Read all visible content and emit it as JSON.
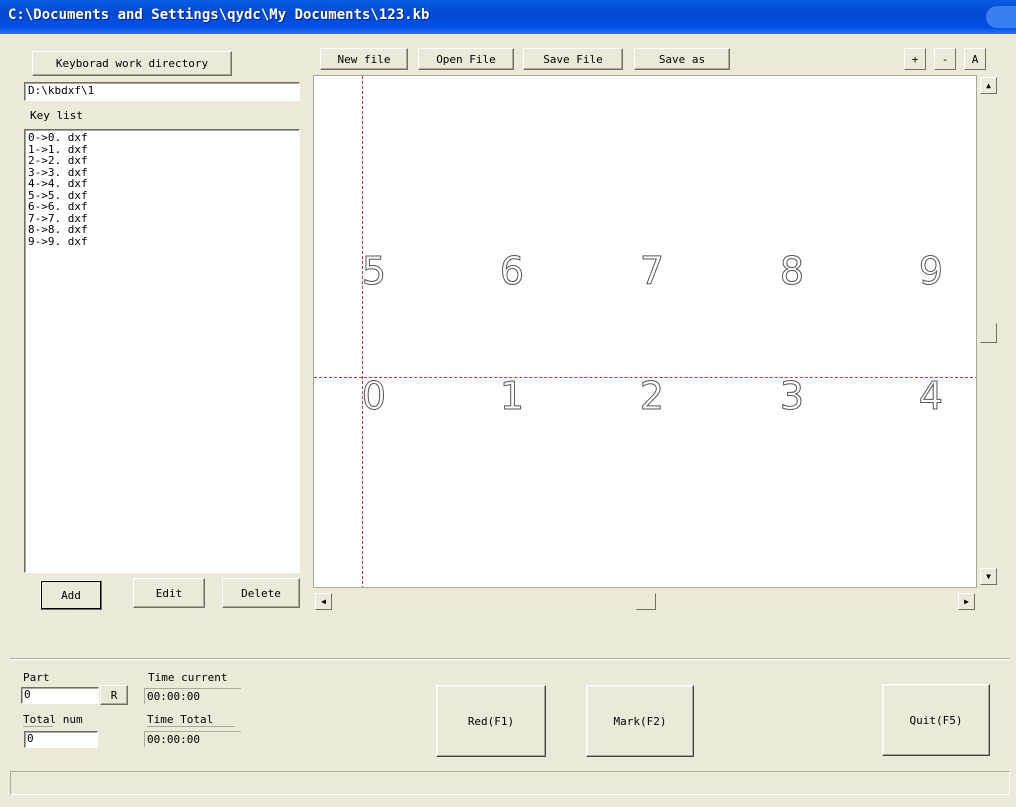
{
  "window": {
    "title": "C:\\Documents and Settings\\qydc\\My Documents\\123.kb"
  },
  "left": {
    "dir_button": "Keyborad work directory",
    "dir_path": "D:\\kbdxf\\1",
    "key_list_label": "Key list",
    "key_items": [
      "0->0. dxf",
      "1->1. dxf",
      "2->2. dxf",
      "3->3. dxf",
      "4->4. dxf",
      "5->5. dxf",
      "6->6. dxf",
      "7->7. dxf",
      "8->8. dxf",
      "9->9. dxf"
    ],
    "add_button": "Add",
    "edit_button": "Edit",
    "delete_button": "Delete"
  },
  "toolbar": {
    "new_file": "New file",
    "open_file": "Open File",
    "save_file": "Save File",
    "save_as": "Save as",
    "zoom_in": "+",
    "zoom_out": "-",
    "zoom_all": "A"
  },
  "canvas": {
    "top_row": [
      "5",
      "6",
      "7",
      "8",
      "9"
    ],
    "bottom_row": [
      "0",
      "1",
      "2",
      "3",
      "4"
    ]
  },
  "bottom": {
    "part_label": "Part",
    "part_value": "0",
    "reset_button": "R",
    "total_label": "Total num",
    "total_value": "0",
    "time_current_label": "Time current",
    "time_current_value": "00:00:00",
    "time_total_label": "Time Total",
    "time_total_value": "00:00:00",
    "red_button": "Red(F1)",
    "mark_button": "Mark(F2)",
    "quit_button": "Quit(F5)"
  },
  "colors": {
    "title_bar": "#0049d0",
    "guide_lines": "#d03030",
    "face": "#ece9d8"
  }
}
